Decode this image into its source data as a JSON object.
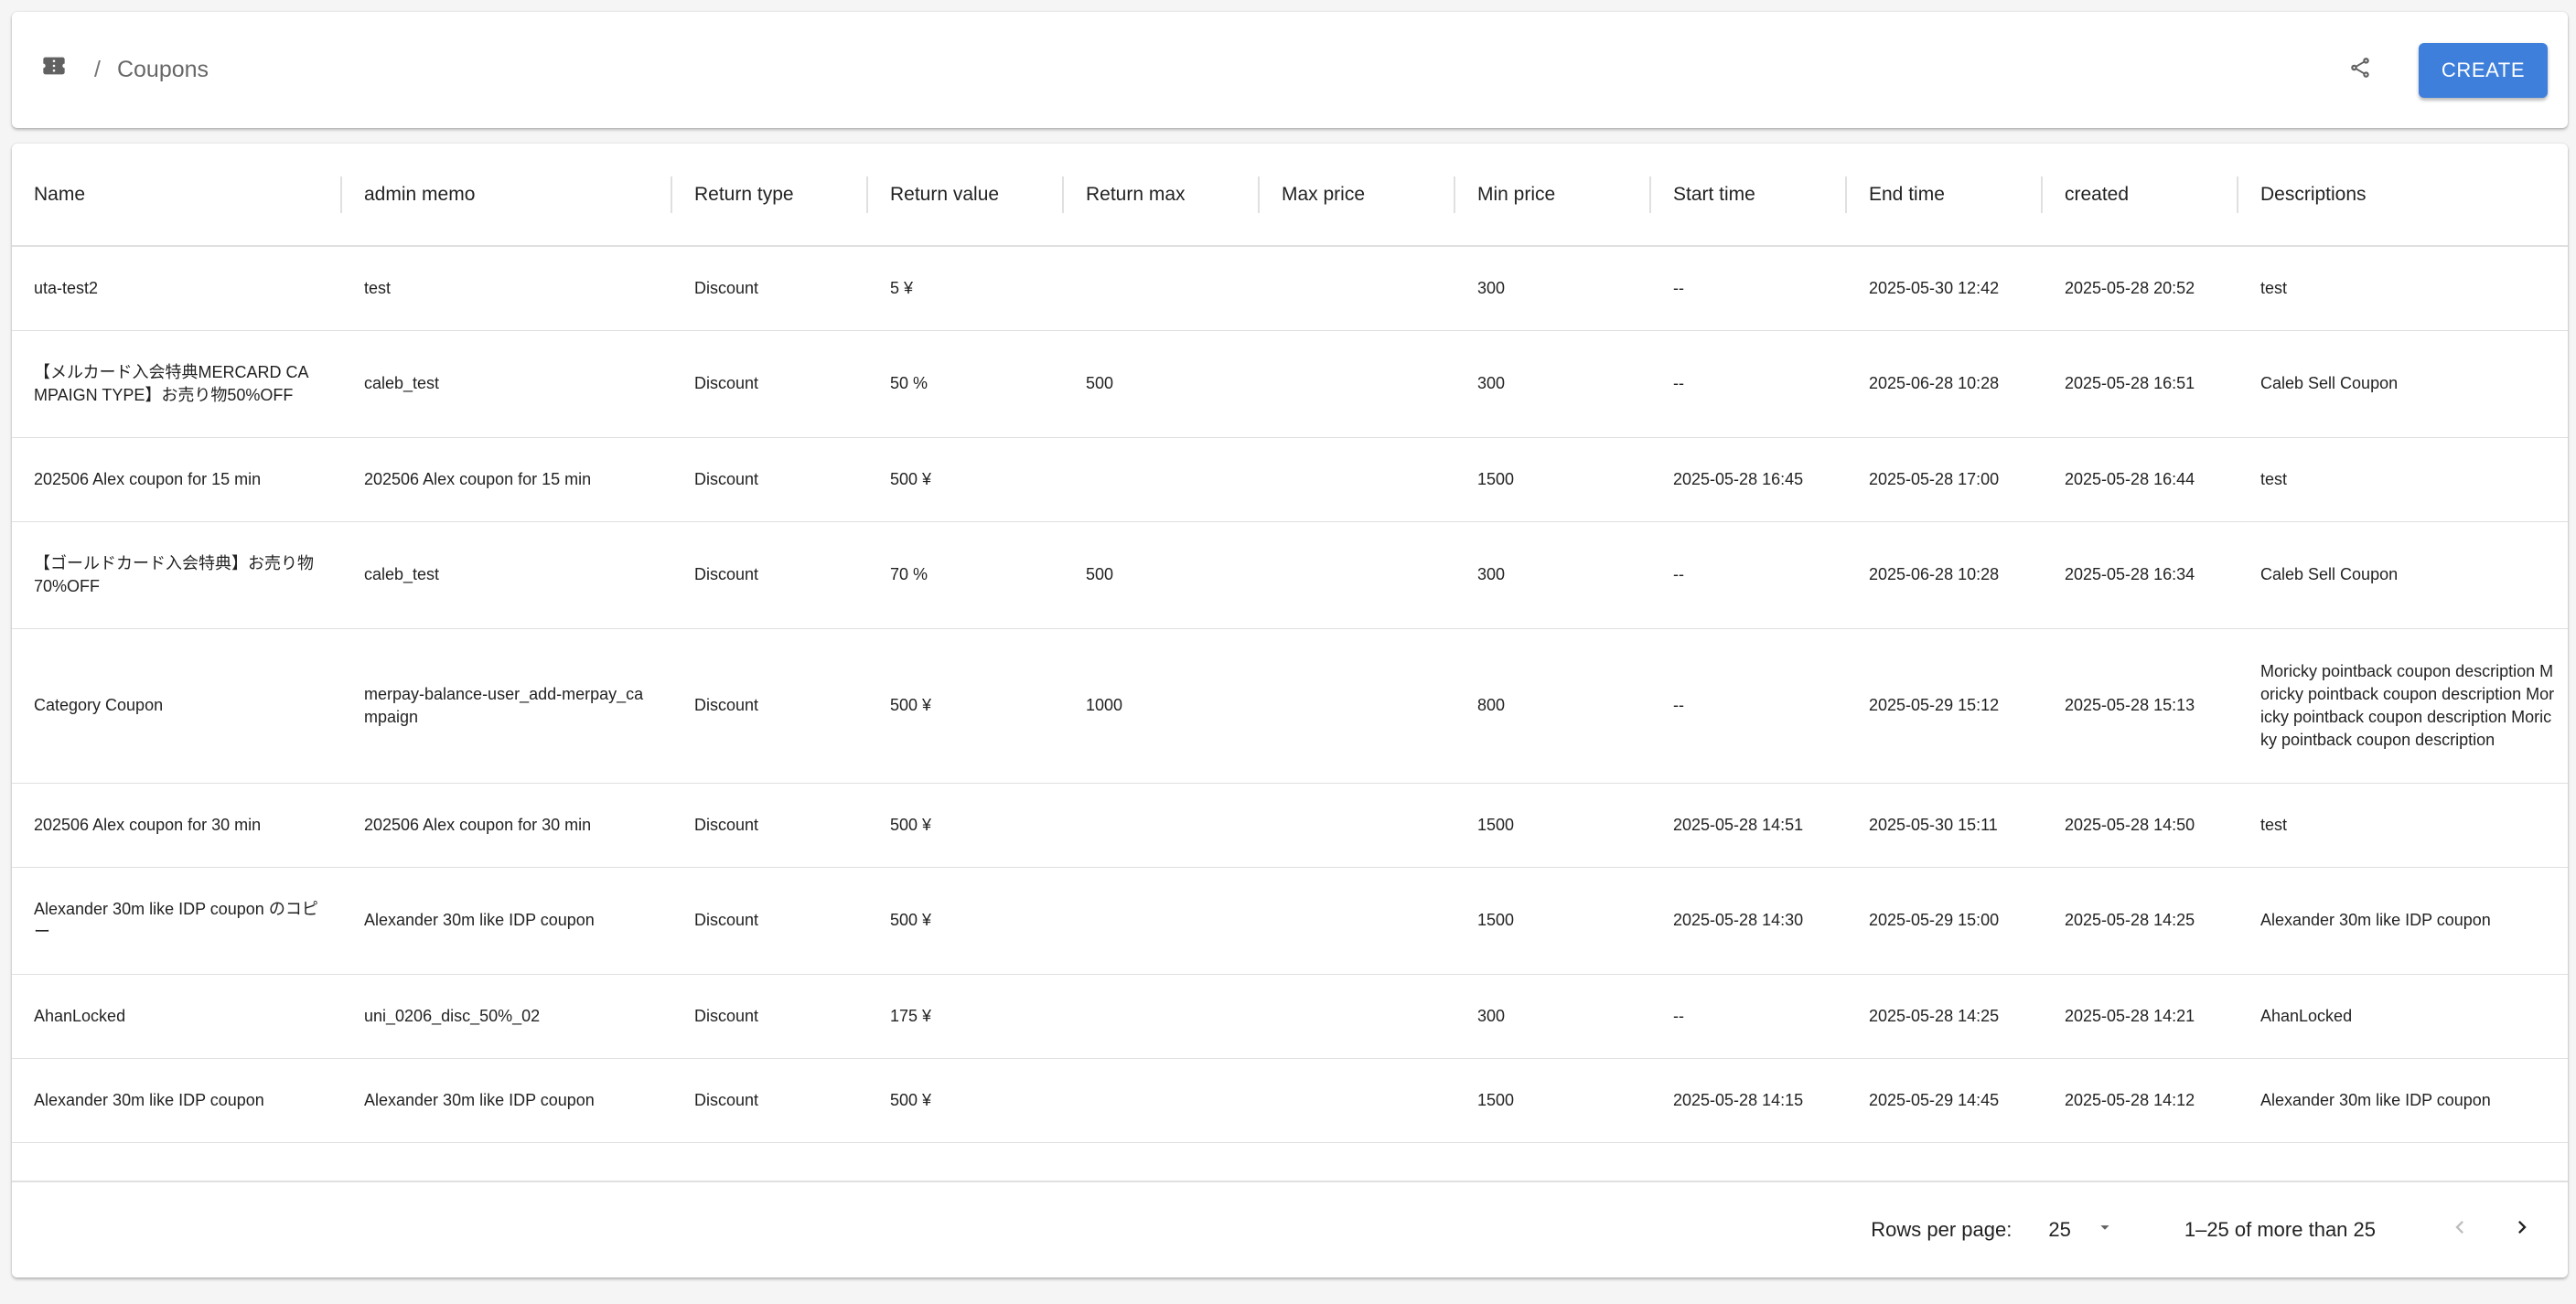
{
  "header": {
    "breadcrumb_icon": "ticket-icon",
    "breadcrumb_separator": "/",
    "breadcrumb_title": "Coupons",
    "share_icon": "share-icon",
    "create_label": "CREATE",
    "create_color": "#3f7fdc"
  },
  "table": {
    "columns": [
      "Name",
      "admin memo",
      "Return type",
      "Return value",
      "Return max",
      "Max price",
      "Min price",
      "Start time",
      "End time",
      "created",
      "Descriptions"
    ],
    "rows": [
      {
        "name": "uta-test2",
        "memo": "test",
        "type": "Discount",
        "value": "5 ¥",
        "max": "",
        "max_price": "",
        "min_price": "300",
        "start": "--",
        "end": "2025-05-30 12:42",
        "created": "2025-05-28 20:52",
        "desc": "test"
      },
      {
        "name": "【メルカード入会特典MERCARD CAMPAIGN TYPE】お売り物50%OFF",
        "memo": "caleb_test",
        "type": "Discount",
        "value": "50 %",
        "max": "500",
        "max_price": "",
        "min_price": "300",
        "start": "--",
        "end": "2025-06-28 10:28",
        "created": "2025-05-28 16:51",
        "desc": "Caleb Sell Coupon"
      },
      {
        "name": "202506 Alex coupon for 15 min",
        "memo": "202506 Alex coupon for 15 min",
        "type": "Discount",
        "value": "500 ¥",
        "max": "",
        "max_price": "",
        "min_price": "1500",
        "start": "2025-05-28 16:45",
        "end": "2025-05-28 17:00",
        "created": "2025-05-28 16:44",
        "desc": "test"
      },
      {
        "name": "【ゴールドカード入会特典】お売り物70%OFF",
        "memo": "caleb_test",
        "type": "Discount",
        "value": "70 %",
        "max": "500",
        "max_price": "",
        "min_price": "300",
        "start": "--",
        "end": "2025-06-28 10:28",
        "created": "2025-05-28 16:34",
        "desc": "Caleb Sell Coupon"
      },
      {
        "name": "Category Coupon",
        "memo": "merpay-balance-user_add-merpay_campaign",
        "type": "Discount",
        "value": "500 ¥",
        "max": "1000",
        "max_price": "",
        "min_price": "800",
        "start": "--",
        "end": "2025-05-29 15:12",
        "created": "2025-05-28 15:13",
        "desc": "Moricky pointback coupon description Moricky pointback coupon description Moricky pointback coupon description Moricky pointback coupon description"
      },
      {
        "name": "202506 Alex coupon for 30 min",
        "memo": "202506 Alex coupon for 30 min",
        "type": "Discount",
        "value": "500 ¥",
        "max": "",
        "max_price": "",
        "min_price": "1500",
        "start": "2025-05-28 14:51",
        "end": "2025-05-30 15:11",
        "created": "2025-05-28 14:50",
        "desc": "test"
      },
      {
        "name": "Alexander 30m like IDP coupon のコピー",
        "memo": "Alexander 30m like IDP coupon",
        "type": "Discount",
        "value": "500 ¥",
        "max": "",
        "max_price": "",
        "min_price": "1500",
        "start": "2025-05-28 14:30",
        "end": "2025-05-29 15:00",
        "created": "2025-05-28 14:25",
        "desc": "Alexander 30m like IDP coupon"
      },
      {
        "name": "AhanLocked",
        "memo": "uni_0206_disc_50%_02",
        "type": "Discount",
        "value": "175 ¥",
        "max": "",
        "max_price": "",
        "min_price": "300",
        "start": "--",
        "end": "2025-05-28 14:25",
        "created": "2025-05-28 14:21",
        "desc": "AhanLocked"
      },
      {
        "name": "Alexander 30m like IDP coupon",
        "memo": "Alexander 30m like IDP coupon",
        "type": "Discount",
        "value": "500 ¥",
        "max": "",
        "max_price": "",
        "min_price": "1500",
        "start": "2025-05-28 14:15",
        "end": "2025-05-29 14:45",
        "created": "2025-05-28 14:12",
        "desc": "Alexander 30m like IDP coupon"
      }
    ]
  },
  "pagination": {
    "rows_per_page_label": "Rows per page:",
    "rows_per_page_value": "25",
    "range_text": "1–25 of more than 25"
  }
}
